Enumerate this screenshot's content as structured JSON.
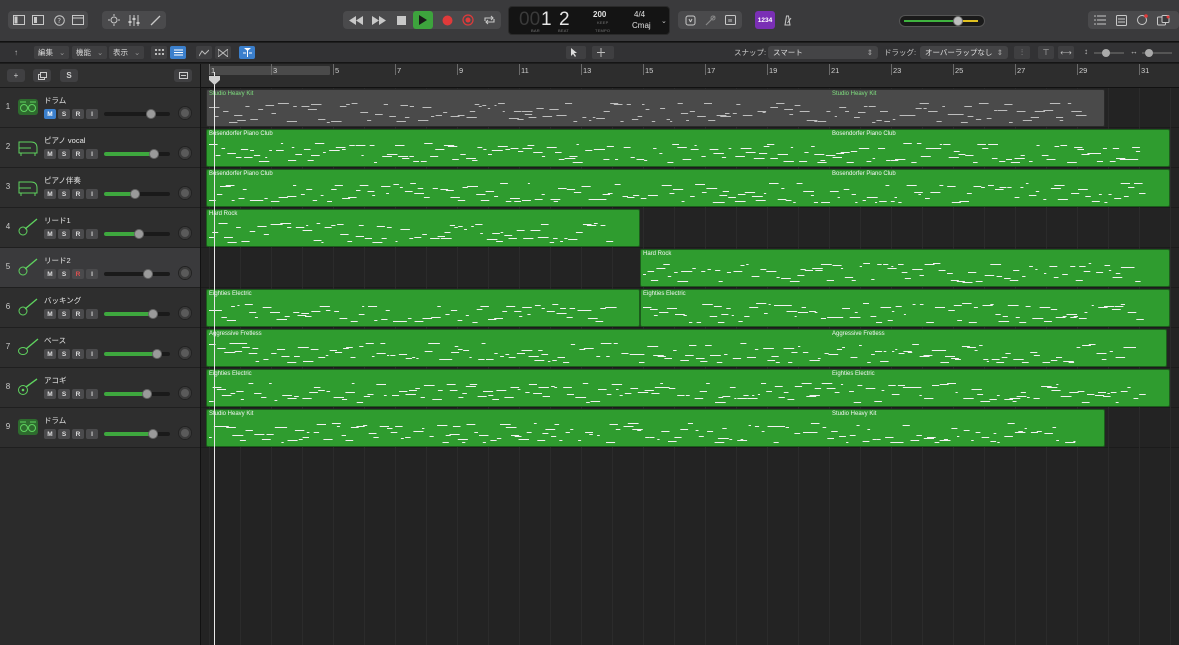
{
  "lcd": {
    "bar_dim": "00",
    "bar": "1",
    "beat": "2",
    "bar_label": "BAR",
    "beat_label": "BEAT",
    "tempo": "200",
    "tempo_mode": "KEEP",
    "tempo_label": "TEMPO",
    "time_sig": "4/4",
    "key": "Cmaj"
  },
  "counter_badge": "1234",
  "toolbar": {
    "edit_menu": "編集",
    "functions_menu": "機能",
    "view_menu": "表示",
    "snap_label": "スナップ:",
    "snap_value": "スマート",
    "drag_label": "ドラッグ:",
    "drag_value": "オーバーラップなし"
  },
  "track_header": {
    "add_label": "+",
    "s_label": "S"
  },
  "ruler": {
    "bars": [
      "1",
      "3",
      "5",
      "7",
      "9",
      "11",
      "13",
      "15",
      "17",
      "19",
      "21",
      "23",
      "25",
      "27",
      "29",
      "31"
    ]
  },
  "tracks": [
    {
      "num": "1",
      "name": "ドラム",
      "icon": "drum-kit-icon",
      "mute": true,
      "rec": false,
      "fader": 0.72,
      "meter": false
    },
    {
      "num": "2",
      "name": "ピアノ vocal",
      "icon": "piano-icon",
      "mute": false,
      "rec": false,
      "fader": 0.78,
      "meter": true
    },
    {
      "num": "3",
      "name": "ピアノ伴奏",
      "icon": "piano-icon",
      "mute": false,
      "rec": false,
      "fader": 0.45,
      "meter": true
    },
    {
      "num": "4",
      "name": "リード1",
      "icon": "guitar-icon",
      "mute": false,
      "rec": false,
      "fader": 0.52,
      "meter": true
    },
    {
      "num": "5",
      "name": "リード2",
      "icon": "guitar-icon",
      "mute": false,
      "rec": true,
      "fader": 0.68,
      "meter": false
    },
    {
      "num": "6",
      "name": "バッキング",
      "icon": "guitar-icon",
      "mute": false,
      "rec": false,
      "fader": 0.76,
      "meter": true
    },
    {
      "num": "7",
      "name": "ベース",
      "icon": "bass-guitar-icon",
      "mute": false,
      "rec": false,
      "fader": 0.82,
      "meter": true
    },
    {
      "num": "8",
      "name": "アコギ",
      "icon": "acoustic-guitar-icon",
      "mute": false,
      "rec": false,
      "fader": 0.66,
      "meter": true
    },
    {
      "num": "9",
      "name": "ドラム",
      "icon": "drum-kit-icon",
      "mute": false,
      "rec": false,
      "fader": 0.76,
      "meter": true
    }
  ],
  "regions": [
    {
      "track": 0,
      "start": 1,
      "end": 30,
      "label": "Studio Heavy Kit",
      "label2": "Studio Heavy Kit",
      "grey": true
    },
    {
      "track": 1,
      "start": 1,
      "end": 32.1,
      "label": "Bosendorfer Piano Club",
      "label2": "Bosendorfer Piano Club",
      "grey": false
    },
    {
      "track": 2,
      "start": 1,
      "end": 32.1,
      "label": "Bosendorfer Piano Club",
      "label2": "Bosendorfer Piano Club",
      "grey": false
    },
    {
      "track": 3,
      "start": 1,
      "end": 15,
      "label": "Hard Rock",
      "label2": "",
      "grey": false
    },
    {
      "track": 4,
      "start": 15,
      "end": 32.1,
      "label": "Hard Rock",
      "label2": "",
      "grey": false
    },
    {
      "track": 5,
      "start": 1,
      "end": 15,
      "label": "Eighties Electric",
      "label2": "",
      "grey": false
    },
    {
      "track": 5,
      "start": 15,
      "end": 32.1,
      "label": "Eighties Electric",
      "label2": "",
      "grey": false
    },
    {
      "track": 6,
      "start": 1,
      "end": 32,
      "label": "Aggressive Fretless",
      "label2": "Aggressive Fretless",
      "grey": false
    },
    {
      "track": 7,
      "start": 1,
      "end": 32.1,
      "label": "Eighties Electric",
      "label2": "Eighties Electric",
      "grey": false
    },
    {
      "track": 8,
      "start": 1,
      "end": 30,
      "label": "Studio Heavy Kit",
      "label2": "Studio Heavy Kit",
      "grey": false
    }
  ]
}
